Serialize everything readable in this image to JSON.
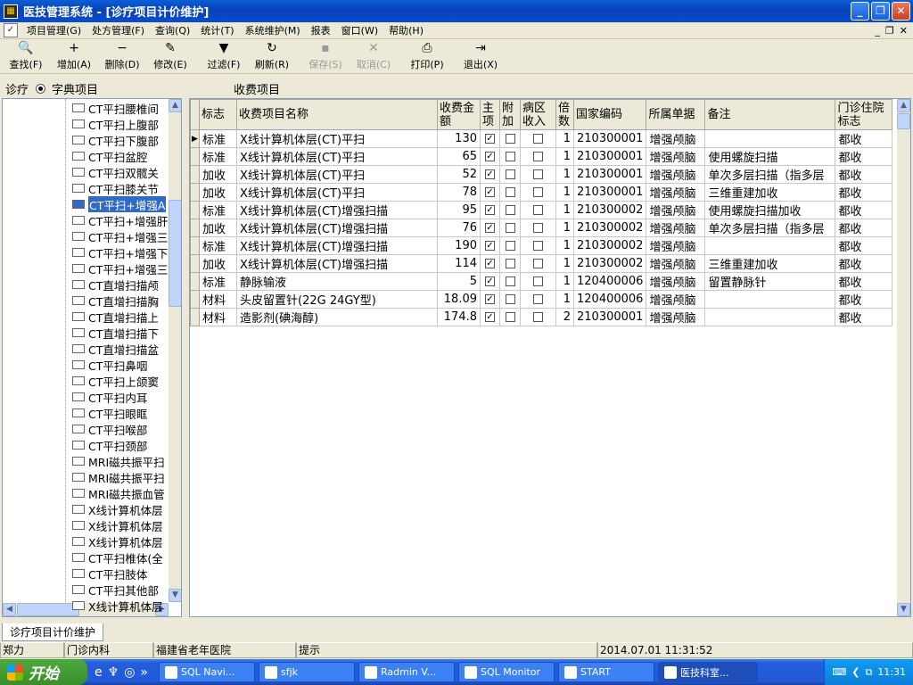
{
  "window": {
    "title": "医技管理系统 - [诊疗项目计价维护]",
    "minimize": "_",
    "restore": "❐",
    "close": "✕"
  },
  "menu": {
    "items": [
      "项目管理(G)",
      "处方管理(F)",
      "查询(Q)",
      "统计(T)",
      "系统维护(M)",
      "报表",
      "窗口(W)",
      "帮助(H)"
    ],
    "mdi_min": "_",
    "mdi_restore": "❐",
    "mdi_close": "✕"
  },
  "toolbar": {
    "buttons": [
      {
        "label": "查找(F)",
        "icon": "binoculars-icon",
        "glyph": "🔍",
        "enabled": true
      },
      {
        "label": "增加(A)",
        "icon": "add-icon",
        "glyph": "+",
        "enabled": true
      },
      {
        "label": "删除(D)",
        "icon": "delete-icon",
        "glyph": "−",
        "enabled": true
      },
      {
        "label": "修改(E)",
        "icon": "edit-icon",
        "glyph": "✎",
        "enabled": true
      },
      {
        "label": "过滤(F)",
        "icon": "filter-icon",
        "glyph": "▼",
        "enabled": true
      },
      {
        "label": "刷新(R)",
        "icon": "refresh-icon",
        "glyph": "↻",
        "enabled": true
      },
      {
        "label": "保存(S)",
        "icon": "save-icon",
        "glyph": "▪",
        "enabled": false
      },
      {
        "label": "取消(C)",
        "icon": "cancel-icon",
        "glyph": "✕",
        "enabled": false
      },
      {
        "label": "打印(P)",
        "icon": "print-icon",
        "glyph": "⎙",
        "enabled": true
      },
      {
        "label": "退出(X)",
        "icon": "exit-icon",
        "glyph": "⇥",
        "enabled": true
      }
    ]
  },
  "labels": {
    "diagnosis": "诊疗",
    "dictionary": "字典项目",
    "charges": "收费项目"
  },
  "tree": {
    "items": [
      "CT平扫腰椎间",
      "CT平扫上腹部",
      "CT平扫下腹部",
      "CT平扫盆腔",
      "CT平扫双髋关",
      "CT平扫膝关节",
      "CT平扫+增强A",
      "CT平扫+增强肝",
      "CT平扫+增强三",
      "CT平扫+增强下",
      "CT平扫+增强三",
      "CT直增扫描颅",
      "CT直增扫描胸",
      "CT直增扫描上",
      "CT直增扫描下",
      "CT直增扫描盆",
      "CT平扫鼻咽",
      "CT平扫上颌窦",
      "CT平扫内耳",
      "CT平扫眼眶",
      "CT平扫喉部",
      "CT平扫颈部",
      "MRI磁共振平扫",
      "MRI磁共振平扫",
      "MRI磁共振血管",
      "X线计算机体层",
      "X线计算机体层",
      "X线计算机体层",
      "CT平扫椎体(全",
      "CT平扫肢体",
      "CT平扫其他部",
      "X线计算机体层"
    ],
    "selected_index": 6
  },
  "grid": {
    "columns": [
      "标志",
      "收费项目名称",
      "收费金额",
      "主项",
      "附加",
      "病区收入",
      "倍数",
      "国家编码",
      "所属单据",
      "备注",
      "门诊住院标志"
    ],
    "rows": [
      {
        "flag": "标准",
        "name": "X线计算机体层(CT)平扫",
        "amount": "130",
        "main": true,
        "extra": false,
        "ward": false,
        "mult": "1",
        "code": "210300001",
        "doc": "增强颅脑",
        "note": "",
        "op": "都收"
      },
      {
        "flag": "标准",
        "name": "X线计算机体层(CT)平扫",
        "amount": "65",
        "main": true,
        "extra": false,
        "ward": false,
        "mult": "1",
        "code": "210300001",
        "doc": "增强颅脑",
        "note": "使用螺旋扫描",
        "op": "都收"
      },
      {
        "flag": "加收",
        "name": "X线计算机体层(CT)平扫",
        "amount": "52",
        "main": true,
        "extra": false,
        "ward": false,
        "mult": "1",
        "code": "210300001",
        "doc": "增强颅脑",
        "note": "单次多层扫描（指多层",
        "op": "都收"
      },
      {
        "flag": "加收",
        "name": "X线计算机体层(CT)平扫",
        "amount": "78",
        "main": true,
        "extra": false,
        "ward": false,
        "mult": "1",
        "code": "210300001",
        "doc": "增强颅脑",
        "note": "三维重建加收",
        "op": "都收"
      },
      {
        "flag": "标准",
        "name": "X线计算机体层(CT)增强扫描",
        "amount": "95",
        "main": true,
        "extra": false,
        "ward": false,
        "mult": "1",
        "code": "210300002",
        "doc": "增强颅脑",
        "note": "使用螺旋扫描加收",
        "op": "都收"
      },
      {
        "flag": "加收",
        "name": "X线计算机体层(CT)增强扫描",
        "amount": "76",
        "main": true,
        "extra": false,
        "ward": false,
        "mult": "1",
        "code": "210300002",
        "doc": "增强颅脑",
        "note": "单次多层扫描（指多层",
        "op": "都收"
      },
      {
        "flag": "标准",
        "name": "X线计算机体层(CT)增强扫描",
        "amount": "190",
        "main": true,
        "extra": false,
        "ward": false,
        "mult": "1",
        "code": "210300002",
        "doc": "增强颅脑",
        "note": "",
        "op": "都收"
      },
      {
        "flag": "加收",
        "name": "X线计算机体层(CT)增强扫描",
        "amount": "114",
        "main": true,
        "extra": false,
        "ward": false,
        "mult": "1",
        "code": "210300002",
        "doc": "增强颅脑",
        "note": "三维重建加收",
        "op": "都收"
      },
      {
        "flag": "标准",
        "name": "静脉输液",
        "amount": "5",
        "main": true,
        "extra": false,
        "ward": false,
        "mult": "1",
        "code": "120400006",
        "doc": "增强颅脑",
        "note": "留置静脉针",
        "op": "都收"
      },
      {
        "flag": "材料",
        "name": "头皮留置针(22G 24GY型)",
        "amount": "18.09",
        "main": true,
        "extra": false,
        "ward": false,
        "mult": "1",
        "code": "120400006",
        "doc": "增强颅脑",
        "note": "",
        "op": "都收"
      },
      {
        "flag": "材料",
        "name": "造影剂(碘海醇)",
        "amount": "174.8",
        "main": true,
        "extra": false,
        "ward": false,
        "mult": "2",
        "code": "210300001",
        "doc": "增强颅脑",
        "note": "",
        "op": "都收"
      }
    ]
  },
  "status": {
    "tab": "诊疗项目计价维护",
    "user": "郑力",
    "dept": "门诊内科",
    "hospital": "福建省老年医院",
    "hint": "提示",
    "datetime": "2014.07.01 11:31:52"
  },
  "taskbar": {
    "start": "开始",
    "tasks": [
      "SQL Navi...",
      "sfjk",
      "Radmin V...",
      "SQL Monitor",
      "START",
      "医技科室..."
    ],
    "clock": "11:31"
  }
}
